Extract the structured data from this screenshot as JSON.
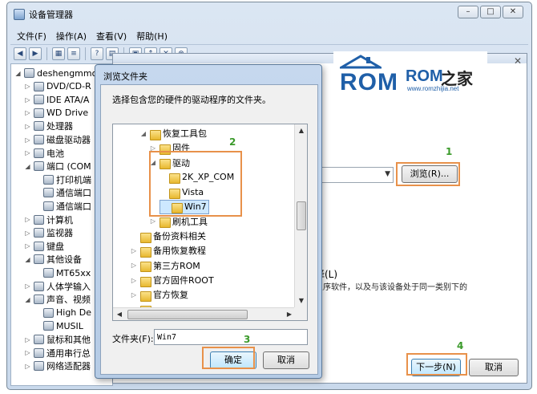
{
  "device_manager": {
    "title": "设备管理器",
    "window_controls": [
      "–",
      "□",
      "✕"
    ],
    "menu": [
      "文件(F)",
      "操作(A)",
      "查看(V)",
      "帮助(H)"
    ],
    "tree": [
      {
        "label": "deshengmmo",
        "twisty": "◢",
        "indent": 0
      },
      {
        "label": "DVD/CD-R",
        "twisty": "▷",
        "indent": 1
      },
      {
        "label": "IDE ATA/A",
        "twisty": "▷",
        "indent": 1
      },
      {
        "label": "WD Drive",
        "twisty": "▷",
        "indent": 1
      },
      {
        "label": "处理器",
        "twisty": "▷",
        "indent": 1
      },
      {
        "label": "磁盘驱动器",
        "twisty": "▷",
        "indent": 1
      },
      {
        "label": "电池",
        "twisty": "▷",
        "indent": 1
      },
      {
        "label": "端口 (COM",
        "twisty": "◢",
        "indent": 1
      },
      {
        "label": "打印机端",
        "twisty": "",
        "indent": 2
      },
      {
        "label": "通信端口",
        "twisty": "",
        "indent": 2
      },
      {
        "label": "通信端口",
        "twisty": "",
        "indent": 2
      },
      {
        "label": "计算机",
        "twisty": "▷",
        "indent": 1
      },
      {
        "label": "监视器",
        "twisty": "▷",
        "indent": 1
      },
      {
        "label": "键盘",
        "twisty": "▷",
        "indent": 1
      },
      {
        "label": "其他设备",
        "twisty": "◢",
        "indent": 1
      },
      {
        "label": "MT65xx",
        "twisty": "",
        "indent": 2
      },
      {
        "label": "人体学输入",
        "twisty": "▷",
        "indent": 1
      },
      {
        "label": "声音、视频",
        "twisty": "◢",
        "indent": 1
      },
      {
        "label": "High De",
        "twisty": "",
        "indent": 2
      },
      {
        "label": "MUSIL",
        "twisty": "",
        "indent": 2
      },
      {
        "label": "鼠标和其他",
        "twisty": "▷",
        "indent": 1
      },
      {
        "label": "通用串行总",
        "twisty": "▷",
        "indent": 1
      },
      {
        "label": "网络适配器",
        "twisty": "▷",
        "indent": 1
      }
    ]
  },
  "wizard": {
    "browse_label": "浏览(R)...",
    "pick_label": "择(L)",
    "pick_desc": "呈序软件，以及与该设备处于同一类别下的",
    "next_label": "下一步(N)",
    "cancel_label": "取消"
  },
  "browse_dialog": {
    "title": "浏览文件夹",
    "description": "选择包含您的硬件的驱动程序的文件夹。",
    "folders": [
      {
        "label": "恢复工具包",
        "twisty": "◢",
        "indent": 1
      },
      {
        "label": "固件",
        "twisty": "▷",
        "indent": 2
      },
      {
        "label": "驱动",
        "twisty": "◢",
        "indent": 2
      },
      {
        "label": "2K_XP_COM",
        "twisty": "",
        "indent": 3
      },
      {
        "label": "Vista",
        "twisty": "",
        "indent": 3
      },
      {
        "label": "Win7",
        "twisty": "",
        "indent": 3,
        "selected": true
      },
      {
        "label": "刷机工具",
        "twisty": "▷",
        "indent": 2
      },
      {
        "label": "备份资料相关",
        "twisty": "",
        "indent": 0
      },
      {
        "label": "备用恢复教程",
        "twisty": "▷",
        "indent": 0
      },
      {
        "label": "第三方ROM",
        "twisty": "▷",
        "indent": 0
      },
      {
        "label": "官方固件ROOT",
        "twisty": "▷",
        "indent": 0
      },
      {
        "label": "官方恢复",
        "twisty": "▷",
        "indent": 0
      },
      {
        "label": "...",
        "twisty": "",
        "indent": 0
      }
    ],
    "folder_field_label": "文件夹(F):",
    "folder_field_value": "Win7",
    "ok_label": "确定",
    "cancel_label": "取消"
  },
  "annotations": [
    "1",
    "2",
    "3",
    "4"
  ],
  "logo": {
    "rom_big": "ROM",
    "rom_small": "ROM",
    "zhijia": "之家",
    "url": "www.romzhijia.net"
  },
  "colors": {
    "highlight": "#e8914a",
    "annotation_number": "#3a9a2a",
    "logo_blue": "#1f5fa8",
    "selection": "#cde8ff"
  }
}
